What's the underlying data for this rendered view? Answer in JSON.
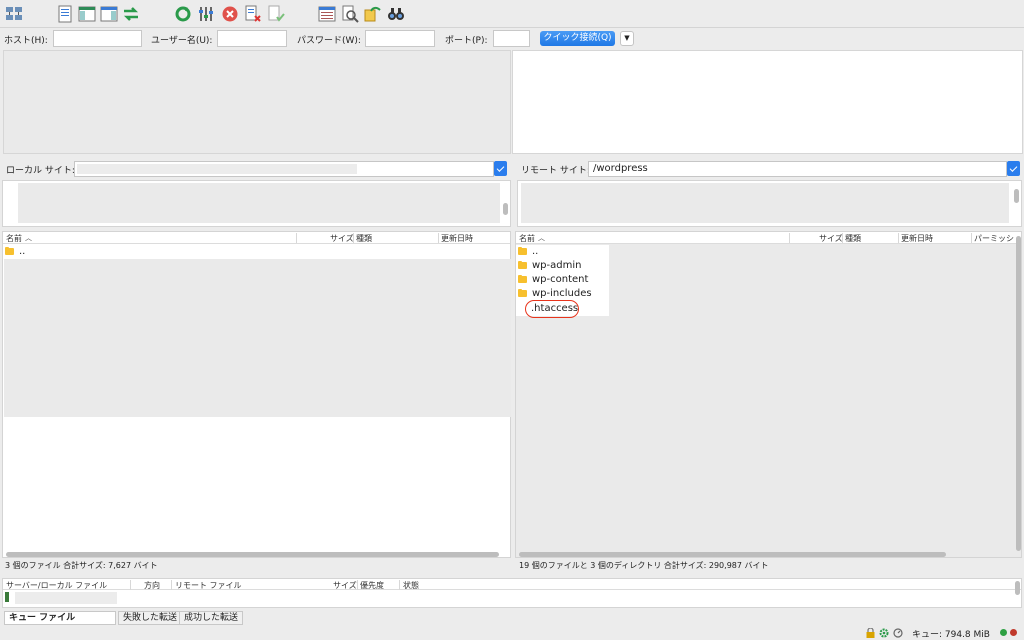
{
  "quickconnect": {
    "host_label": "ホスト(H):",
    "user_label": "ユーザー名(U):",
    "pass_label": "パスワード(W):",
    "port_label": "ポート(P):",
    "button_label": "クイック接続(Q)",
    "host_value": "",
    "user_value": "",
    "pass_value": "",
    "port_value": ""
  },
  "local": {
    "site_label": "ローカル サイト:",
    "site_path": "",
    "columns": [
      "名前",
      "サイズ",
      "種類",
      "更新日時"
    ],
    "files": [
      {
        "name": "..",
        "type": "folder"
      }
    ],
    "status": "3 個のファイル 合計サイズ: 7,627 バイト"
  },
  "remote": {
    "site_label": "リモート サイト:",
    "site_path": "/wordpress",
    "columns": [
      "名前",
      "サイズ",
      "種類",
      "更新日時",
      "パーミッシ"
    ],
    "files": [
      {
        "name": "..",
        "type": "folder"
      },
      {
        "name": "wp-admin",
        "type": "folder"
      },
      {
        "name": "wp-content",
        "type": "folder"
      },
      {
        "name": "wp-includes",
        "type": "folder"
      },
      {
        "name": ".htaccess",
        "type": "file"
      }
    ],
    "status": "19 個のファイルと 3 個のディレクトリ 合計サイズ: 290,987 バイト"
  },
  "queue": {
    "columns": [
      "サーバー/ローカル ファイル",
      "方向",
      "リモート ファイル",
      "サイズ",
      "優先度",
      "状態"
    ],
    "tabs": [
      "キュー ファイル",
      "失敗した転送",
      "成功した転送"
    ]
  },
  "statusbar": {
    "queue_text": "キュー: 794.8 MiB"
  },
  "colors": {
    "accent": "#1f78e6",
    "folder": "#f7c02e",
    "highlight_circle": "#e8341c"
  }
}
